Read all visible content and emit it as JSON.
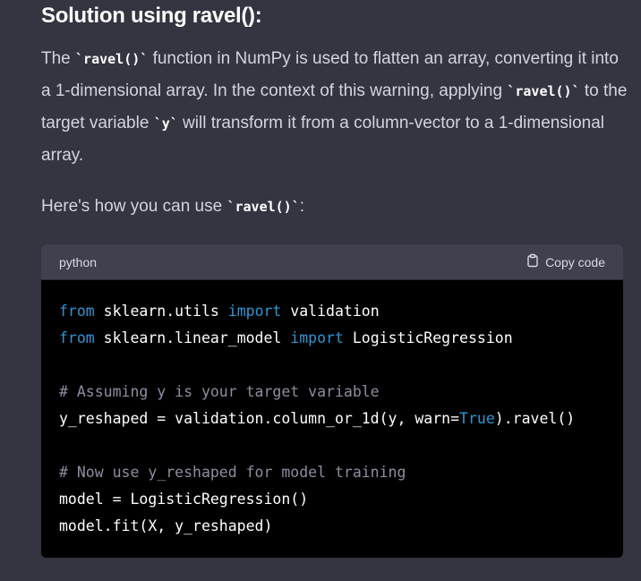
{
  "heading": "Solution using ravel():",
  "paragraph": {
    "l1_a": "The ",
    "l1_code": "`ravel()`",
    "l1_b": " function in NumPy is used to flatten an array, converting it into a 1-dimensional array. In the context of this warning, applying ",
    "l2_code": "`ravel()`",
    "l2_b": " to the target variable ",
    "l2_code2": "`y`",
    "l2_c": " will transform it from a column-vector to a 1-dimensional array."
  },
  "paragraph2": {
    "text": "Here's how you can use ",
    "code": "`ravel()`",
    "end": ":"
  },
  "codeblock": {
    "language": "python",
    "copy_label": "Copy code",
    "copy_icon": "clipboard-icon",
    "lines": {
      "l1_kw1": "from",
      "l1_a": " sklearn.utils ",
      "l1_kw2": "import",
      "l1_b": " validation",
      "l2_kw1": "from",
      "l2_a": " sklearn.linear_model ",
      "l2_kw2": "import",
      "l2_b": " LogisticRegression",
      "l4_comment": "# Assuming y is your target variable",
      "l5_a": "y_reshaped = validation.column_or_1d(y, warn=",
      "l5_true": "True",
      "l5_b": ").ravel()",
      "l7_comment": "# Now use y_reshaped for model training",
      "l8": "model = LogisticRegression()",
      "l9": "model.fit(X, y_reshaped)"
    }
  },
  "colors": {
    "background": "#343541",
    "code_bg": "#000000",
    "keyword": "#2e95d3",
    "comment": "#8e8ea0"
  }
}
